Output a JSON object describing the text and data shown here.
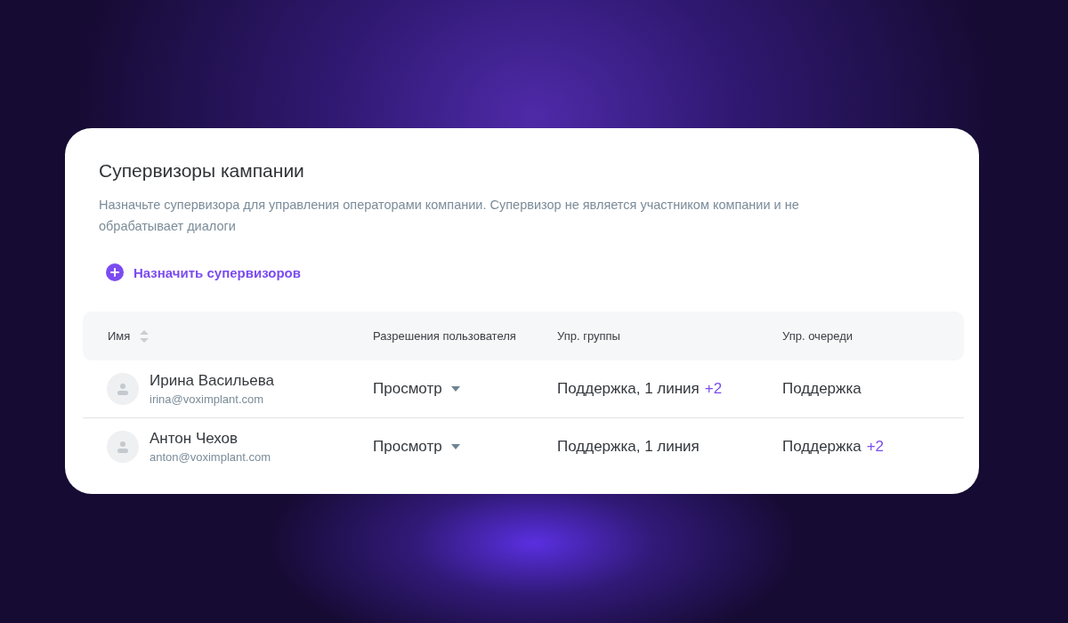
{
  "title": "Супервизоры кампании",
  "description": "Назначьте супервизора для управления операторами компании. Супервизор не является участником компании и не обрабатывает диалоги",
  "add_button": "Назначить супервизоров",
  "columns": [
    {
      "label": "Имя",
      "sortable": true
    },
    {
      "label": "Разрешения пользователя",
      "sortable": false
    },
    {
      "label": "Упр. группы",
      "sortable": false
    },
    {
      "label": "Упр. очереди",
      "sortable": false
    }
  ],
  "rows": [
    {
      "name": "Ирина Васильева",
      "email": "irina@voximplant.com",
      "permission": "Просмотр",
      "groups": {
        "text": "Поддержка, 1 линия",
        "more": "+2"
      },
      "queues": {
        "text": "Поддержка"
      }
    },
    {
      "name": "Антон Чехов",
      "email": "anton@voximplant.com",
      "permission": "Просмотр",
      "groups": {
        "text": "Поддержка, 1 линия"
      },
      "queues": {
        "text": "Поддержка",
        "more": "+2"
      }
    }
  ]
}
